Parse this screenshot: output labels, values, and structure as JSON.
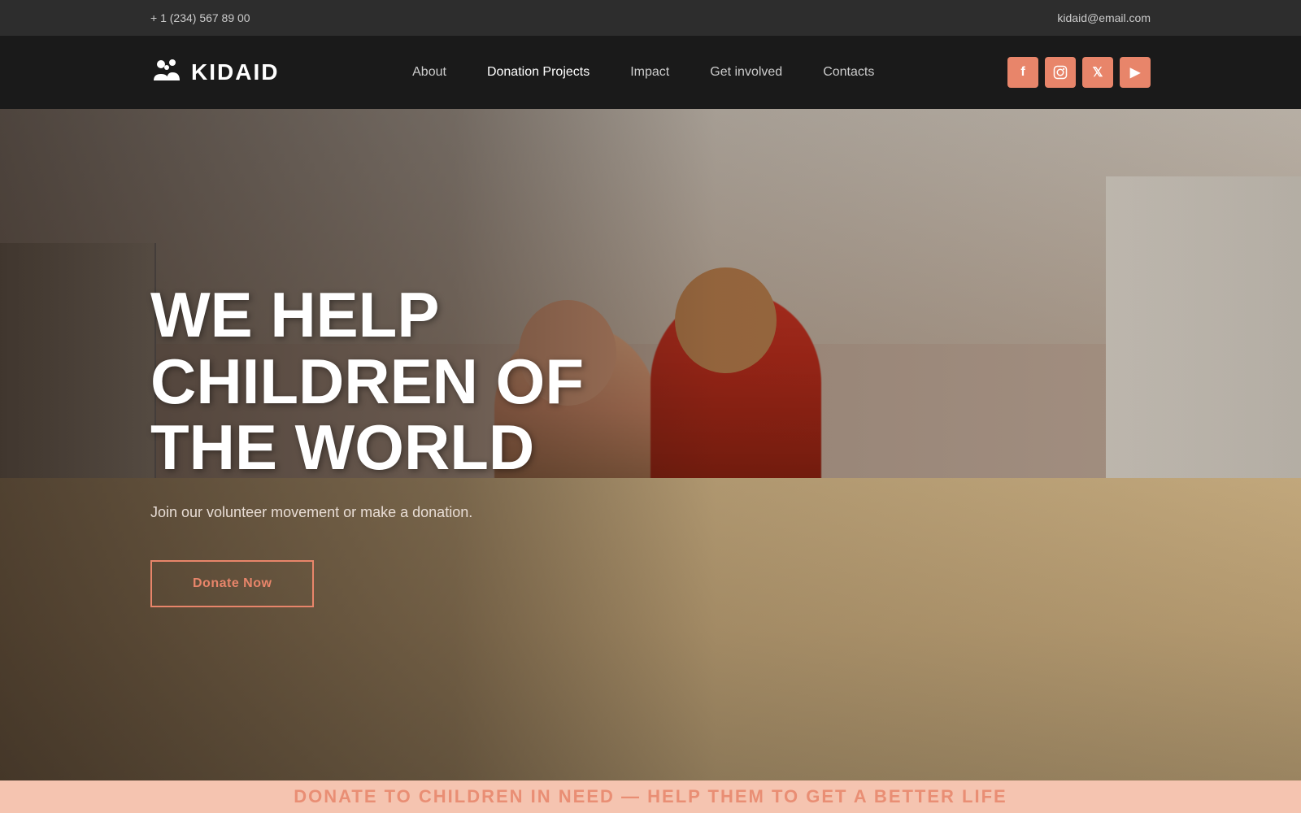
{
  "topbar": {
    "phone": "+ 1 (234) 567 89 00",
    "email": "kidaid@email.com"
  },
  "navbar": {
    "logo_text": "KIDAID",
    "links": [
      {
        "label": "About",
        "active": false
      },
      {
        "label": "Donation Projects",
        "active": true
      },
      {
        "label": "Impact",
        "active": false
      },
      {
        "label": "Get involved",
        "active": false
      },
      {
        "label": "Contacts",
        "active": false
      }
    ],
    "social": [
      {
        "name": "facebook",
        "icon": "f"
      },
      {
        "name": "instagram",
        "icon": "in"
      },
      {
        "name": "twitter",
        "icon": "t"
      },
      {
        "name": "youtube",
        "icon": "▶"
      }
    ]
  },
  "hero": {
    "title": "WE HELP CHILDREN OF THE WORLD",
    "subtitle": "Join our volunteer movement or make a donation.",
    "cta_label": "Donate Now"
  },
  "bottom_banner": {
    "text": "DONATE TO CHILDREN IN NEED — HELP THEM TO GET A BETTER LIFE"
  }
}
